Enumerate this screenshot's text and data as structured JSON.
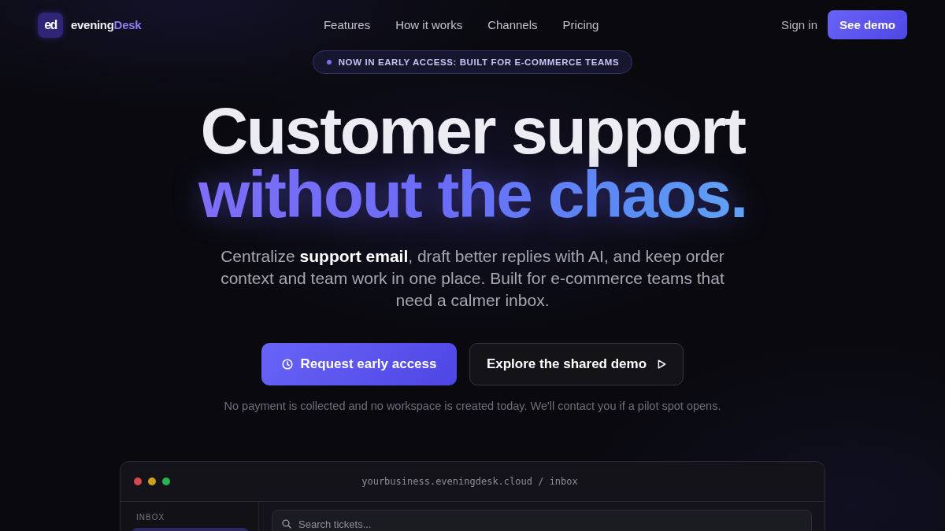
{
  "nav": {
    "brand": {
      "logo": "ed",
      "name": "evening",
      "accent": "Desk"
    },
    "links": [
      {
        "label": "Features"
      },
      {
        "label": "How it works"
      },
      {
        "label": "Channels"
      },
      {
        "label": "Pricing"
      }
    ],
    "sign_in": "Sign in",
    "cta": "See demo"
  },
  "announcement": {
    "text": "NOW IN EARLY ACCESS: BUILT FOR E-COMMERCE TEAMS"
  },
  "hero": {
    "title_line_1": "Customer support",
    "title_line_2": "without the chaos.",
    "subtitle": "Centralize **support email**, draft better replies with AI, and keep order context and team work in one place. Built for e-commerce teams that need a calmer inbox.",
    "buttons": [
      {
        "kind": "primary",
        "label": "Request early access"
      },
      {
        "kind": "secondary",
        "label": "Explore the shared demo"
      }
    ],
    "note": "No payment is collected and no workspace is created today. We'll contact you if a pilot spot opens."
  },
  "preview": {
    "address": "yourbusiness.eveningdesk.cloud / inbox",
    "sidebar": {
      "heading": "INBOX",
      "items": [
        {
          "selected": true
        }
      ]
    },
    "search": {
      "placeholder": "Search tickets..."
    }
  }
}
